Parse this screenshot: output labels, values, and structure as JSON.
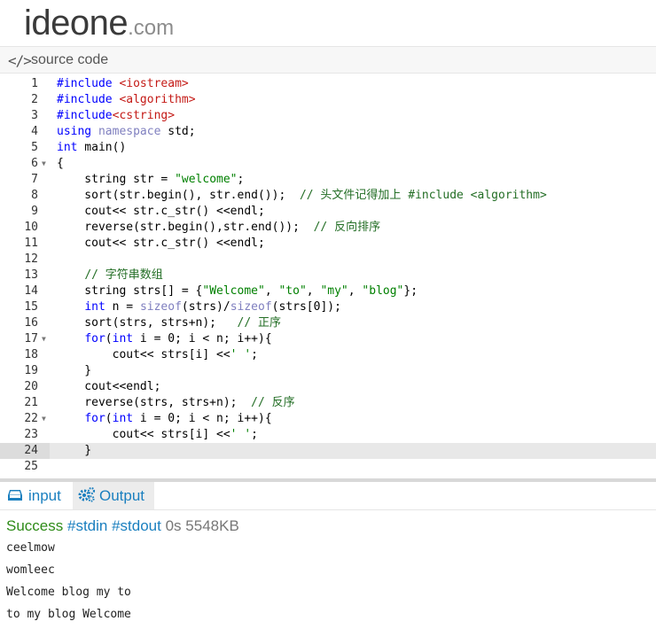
{
  "header": {
    "logo_main": "ideone",
    "logo_tld": ".com"
  },
  "source_bar": {
    "icon": "</>",
    "label": "source code"
  },
  "editor": {
    "active_line": 24,
    "folded_lines": [
      6,
      17,
      22
    ]
  },
  "code_lines": [
    "#include <iostream>",
    "#include <algorithm>",
    "#include<cstring>",
    "using namespace std;",
    "int main()",
    "{",
    "    string str = \"welcome\";",
    "    sort(str.begin(), str.end());  // 头文件记得加上 #include <algorithm>",
    "    cout<< str.c_str() <<endl;",
    "    reverse(str.begin(),str.end());  // 反向排序",
    "    cout<< str.c_str() <<endl;",
    "",
    "    // 字符串数组",
    "    string strs[] = {\"Welcome\", \"to\", \"my\", \"blog\"};",
    "    int n = sizeof(strs)/sizeof(strs[0]);",
    "    sort(strs, strs+n);   // 正序",
    "    for(int i = 0; i < n; i++){",
    "        cout<< strs[i] <<' ';",
    "    }",
    "    cout<<endl;",
    "    reverse(strs, strs+n);  // 反序",
    "    for(int i = 0; i < n; i++){",
    "        cout<< strs[i] <<' ';",
    "    }",
    ""
  ],
  "tabs": {
    "input": "input",
    "output": "Output"
  },
  "status": {
    "result": "Success",
    "stdin": "#stdin",
    "stdout": "#stdout",
    "time": "0s",
    "memory": "5548KB"
  },
  "output_lines": [
    "ceelmow",
    "womleec",
    "Welcome blog my to",
    "to my blog Welcome"
  ],
  "colors": {
    "keyword": "#0000ff",
    "include_target": "#c41a16",
    "string": "#008000",
    "comment": "#236e25",
    "link": "#1a7fbf",
    "success": "#2e8b18"
  }
}
